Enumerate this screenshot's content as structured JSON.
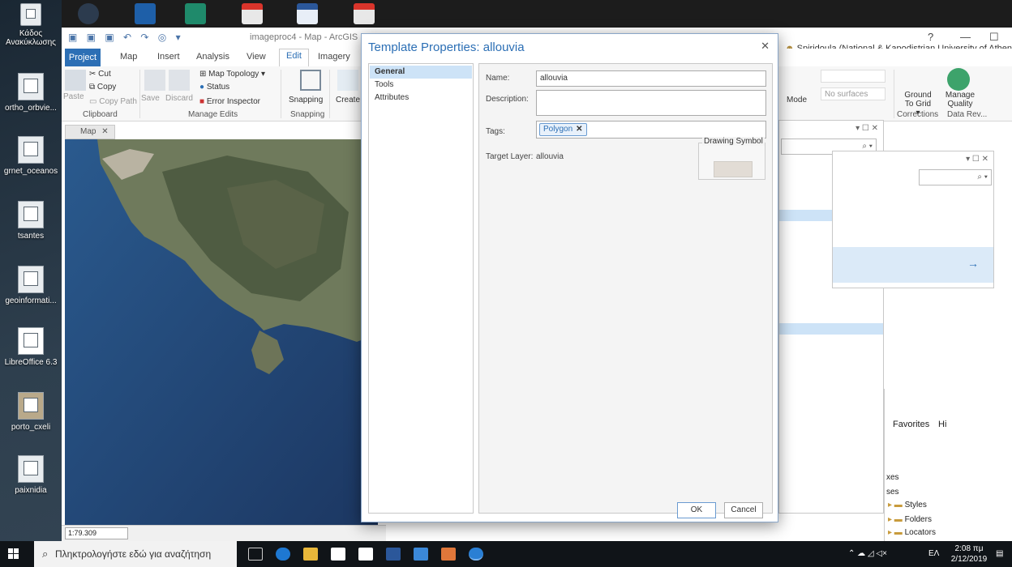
{
  "desktop": {
    "icons": [
      {
        "label": "Κάδος Ανακύκλωσης",
        "icon": "recycle-bin-icon"
      },
      {
        "label": "ortho_orbvie...",
        "icon": "image-file-icon"
      },
      {
        "label": "grnet_oceanos",
        "icon": "document-icon"
      },
      {
        "label": "tsantes",
        "icon": "document-icon"
      },
      {
        "label": "geoinformati...",
        "icon": "document-icon"
      },
      {
        "label": "LibreOffice 6.3",
        "icon": "libreoffice-shortcut-icon"
      },
      {
        "label": "porto_cxeli",
        "icon": "image-file-icon"
      },
      {
        "label": "paixnidia",
        "icon": "document-icon"
      }
    ]
  },
  "arcgis": {
    "window_title": "imageproc4 - Map - ArcGIS Pro",
    "help": "?",
    "user": "Spiridoula (National & Kapodistrian University of Athens) ▾",
    "tabs": [
      "Project",
      "Map",
      "Insert",
      "Analysis",
      "View",
      "Edit",
      "Imagery"
    ],
    "ribbon": {
      "clipboard": {
        "cut": "Cut",
        "copy": "Copy",
        "paste": "Paste",
        "copy_path": "Copy Path",
        "group": "Clipboard"
      },
      "manage_edits": {
        "save": "Save",
        "discard": "Discard",
        "map_topology": "Map Topology",
        "status": "Status",
        "error_inspector": "Error Inspector",
        "group": "Manage Edits"
      },
      "snapping": {
        "label": "Snapping",
        "group": "Snapping"
      },
      "create": "Create",
      "mode": "Mode",
      "surfaces": "No surfaces",
      "ground_to_grid": "Ground To Grid ▾",
      "manage_quality": "Manage Quality",
      "corrections_group": "Corrections",
      "data_rev_group": "Data Rev..."
    },
    "map_tab": "Map",
    "scale": "1:79.309",
    "catalog": {
      "favorites": "Favorites",
      "history": "Hi",
      "items": [
        "Styles",
        "Folders",
        "Locators"
      ],
      "partial": [
        "xes",
        "ses"
      ]
    }
  },
  "dialog": {
    "title": "Template Properties: allouvia",
    "nav": [
      "General",
      "Tools",
      "Attributes"
    ],
    "labels": {
      "name": "Name:",
      "description": "Description:",
      "tags": "Tags:",
      "target_layer": "Target Layer:",
      "drawing_symbol": "Drawing Symbol"
    },
    "name_value": "allouvia",
    "description_value": "",
    "tag": "Polygon",
    "target_layer_value": "allouvia",
    "ok": "OK",
    "cancel": "Cancel"
  },
  "taskbar": {
    "search_placeholder": "Πληκτρολογήστε εδώ για αναζήτηση",
    "lang": "ΕΛ",
    "time": "2:08 πμ",
    "date": "2/12/2019"
  }
}
